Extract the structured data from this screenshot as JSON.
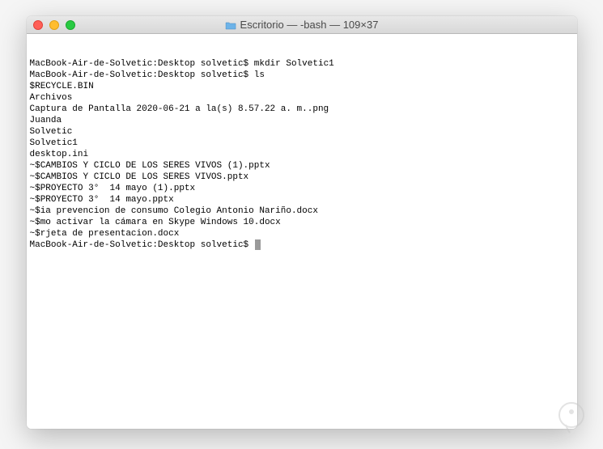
{
  "window": {
    "title": "Escritorio — -bash — 109×37"
  },
  "terminal": {
    "lines": [
      {
        "prompt": "MacBook-Air-de-Solvetic:Desktop solvetic$ ",
        "command": "mkdir Solvetic1"
      },
      {
        "prompt": "MacBook-Air-de-Solvetic:Desktop solvetic$ ",
        "command": "ls"
      },
      {
        "text": "$RECYCLE.BIN"
      },
      {
        "text": "Archivos"
      },
      {
        "text": "Captura de Pantalla 2020-06-21 a la(s) 8.57.22 a. m..png"
      },
      {
        "text": "Juanda"
      },
      {
        "text": "Solvetic"
      },
      {
        "text": "Solvetic1"
      },
      {
        "text": "desktop.ini"
      },
      {
        "text": "~$CAMBIOS Y CICLO DE LOS SERES VIVOS (1).pptx"
      },
      {
        "text": "~$CAMBIOS Y CICLO DE LOS SERES VIVOS.pptx"
      },
      {
        "text": "~$PROYECTO 3°  14 mayo (1).pptx"
      },
      {
        "text": "~$PROYECTO 3°  14 mayo.pptx"
      },
      {
        "text": "~$ia prevencion de consumo Colegio Antonio Nariño.docx"
      },
      {
        "text": "~$mo activar la cámara en Skype Windows 10.docx"
      },
      {
        "text": "~$rjeta de presentacion.docx"
      },
      {
        "prompt": "MacBook-Air-de-Solvetic:Desktop solvetic$ ",
        "command": "",
        "cursor": true
      }
    ]
  }
}
